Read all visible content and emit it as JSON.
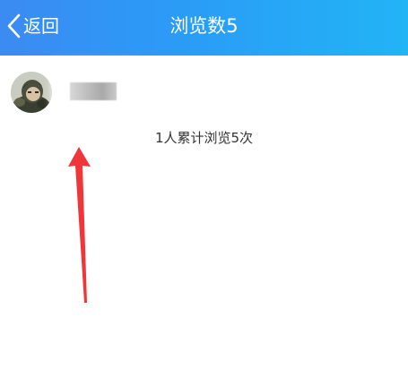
{
  "nav": {
    "back_label": "返回",
    "title": "浏览数5",
    "gradient_start": "#3b8bf2",
    "gradient_end": "#22b4f5",
    "text_color": "#ffffff"
  },
  "viewer": {
    "avatar_icon": "avatar-icon",
    "name_redacted": true
  },
  "summary": {
    "text": "1人累计浏览5次"
  },
  "annotation": {
    "arrow_color": "#f0363a",
    "arrow_icon": "red-arrow-up-icon"
  }
}
